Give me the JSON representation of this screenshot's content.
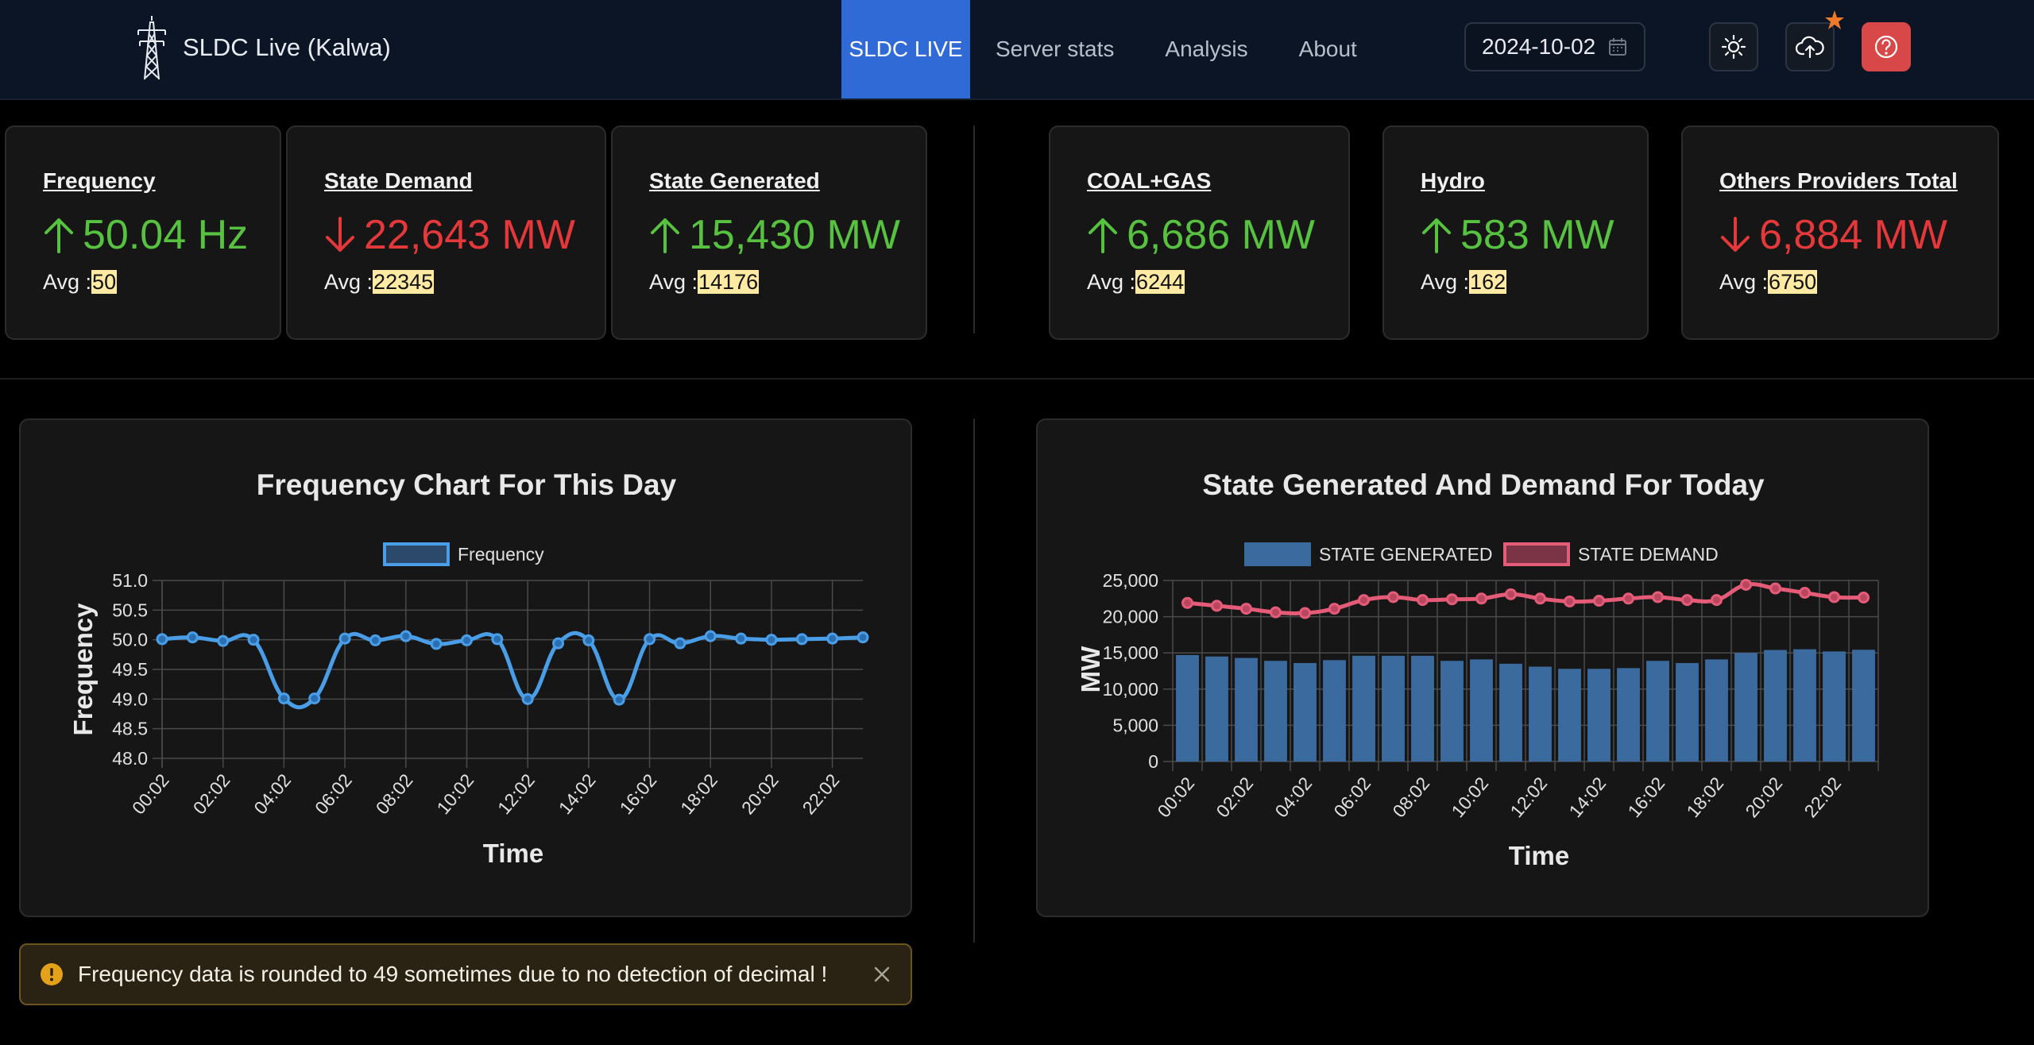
{
  "navbar": {
    "brand_icon": "transmission-tower-icon",
    "brand": "SLDC Live (Kalwa)",
    "links": [
      "SLDC LIVE",
      "Server stats",
      "Analysis",
      "About"
    ],
    "active_link": "SLDC LIVE",
    "date": "2024-10-02",
    "icons": [
      "calendar-icon",
      "sun-icon",
      "cloud-upload-icon",
      "help-icon"
    ]
  },
  "stats": [
    {
      "title": "Frequency",
      "value": "50.04",
      "unit": "Hz",
      "trend": "up",
      "avg_label": "Avg :",
      "avg": "50"
    },
    {
      "title": "State Demand",
      "value": "22,643",
      "unit": "MW",
      "trend": "down",
      "avg_label": "Avg :",
      "avg": "22345"
    },
    {
      "title": "State Generated",
      "value": "15,430",
      "unit": "MW",
      "trend": "up",
      "avg_label": "Avg :",
      "avg": "14176"
    },
    {
      "title": "COAL+GAS",
      "value": "6,686",
      "unit": "MW",
      "trend": "up",
      "avg_label": "Avg :",
      "avg": "6244"
    },
    {
      "title": "Hydro",
      "value": "583",
      "unit": "MW",
      "trend": "up",
      "avg_label": "Avg :",
      "avg": "162"
    },
    {
      "title": "Others Providers Total",
      "value": "6,884",
      "unit": "MW",
      "trend": "down",
      "avg_label": "Avg :",
      "avg": "6750"
    }
  ],
  "colors": {
    "up": "#57c140",
    "down": "#e5383b",
    "frequency_line": "#4a9ee8",
    "generated_bar": "#3b6a9e",
    "demand_line": "#e45c78",
    "accent": "#2f6ad6"
  },
  "chart_data": [
    {
      "type": "line",
      "title": "Frequency Chart For This Day",
      "xlabel": "Time",
      "ylabel": "Frequency",
      "x_ticks": [
        "00:02",
        "02:02",
        "04:02",
        "06:02",
        "08:02",
        "10:02",
        "12:02",
        "14:02",
        "16:02",
        "18:02",
        "20:02",
        "22:02"
      ],
      "x": [
        "00:02",
        "01:02",
        "02:02",
        "03:02",
        "04:02",
        "05:02",
        "06:02",
        "07:02",
        "08:02",
        "09:02",
        "10:02",
        "11:02",
        "12:02",
        "13:02",
        "14:02",
        "15:02",
        "16:02",
        "17:02",
        "18:02",
        "19:02",
        "20:02",
        "21:02",
        "22:02",
        "23:02"
      ],
      "series": [
        {
          "name": "Frequency",
          "values": [
            50.01,
            50.04,
            49.98,
            50.0,
            49.01,
            49.01,
            50.02,
            49.99,
            50.06,
            49.93,
            49.99,
            50.01,
            49.0,
            49.94,
            49.99,
            48.99,
            50.01,
            49.94,
            50.06,
            50.02,
            50.0,
            50.01,
            50.02,
            50.04
          ]
        }
      ],
      "y_ticks": [
        "48.0",
        "48.5",
        "49.0",
        "49.5",
        "50.0",
        "50.5",
        "51.0"
      ],
      "ylim": [
        48.0,
        51.0
      ],
      "grid": true,
      "legend": "top"
    },
    {
      "type": "bar",
      "title": "State Generated And Demand For Today",
      "xlabel": "Time",
      "ylabel": "MW",
      "x_ticks": [
        "00:02",
        "02:02",
        "04:02",
        "06:02",
        "08:02",
        "10:02",
        "12:02",
        "14:02",
        "16:02",
        "18:02",
        "20:02",
        "22:02"
      ],
      "x": [
        "00:02",
        "01:02",
        "02:02",
        "03:02",
        "04:02",
        "05:02",
        "06:02",
        "07:02",
        "08:02",
        "09:02",
        "10:02",
        "11:02",
        "12:02",
        "13:02",
        "14:02",
        "15:02",
        "16:02",
        "17:02",
        "18:02",
        "19:02",
        "20:02",
        "21:02",
        "22:02",
        "23:02"
      ],
      "series": [
        {
          "name": "STATE GENERATED",
          "type": "bar",
          "values": [
            14700,
            14500,
            14300,
            13900,
            13600,
            14000,
            14600,
            14600,
            14600,
            13900,
            14100,
            13500,
            13100,
            12800,
            12800,
            12900,
            13900,
            13600,
            14100,
            15000,
            15400,
            15500,
            15200,
            15430
          ]
        },
        {
          "name": "STATE DEMAND",
          "type": "line",
          "values": [
            21900,
            21500,
            21100,
            20600,
            20500,
            21100,
            22300,
            22700,
            22300,
            22400,
            22500,
            23100,
            22500,
            22100,
            22200,
            22500,
            22700,
            22300,
            22300,
            24400,
            23900,
            23300,
            22700,
            22643
          ]
        }
      ],
      "y_ticks": [
        "0",
        "5,000",
        "10,000",
        "15,000",
        "20,000",
        "25,000"
      ],
      "ylim": [
        0,
        25000
      ],
      "grid": true,
      "legend": "top"
    }
  ],
  "alert": {
    "icon": "warning-icon",
    "text": "Frequency data is rounded to 49 sometimes due to no detection of decimal !",
    "close_icon": "close-icon"
  }
}
